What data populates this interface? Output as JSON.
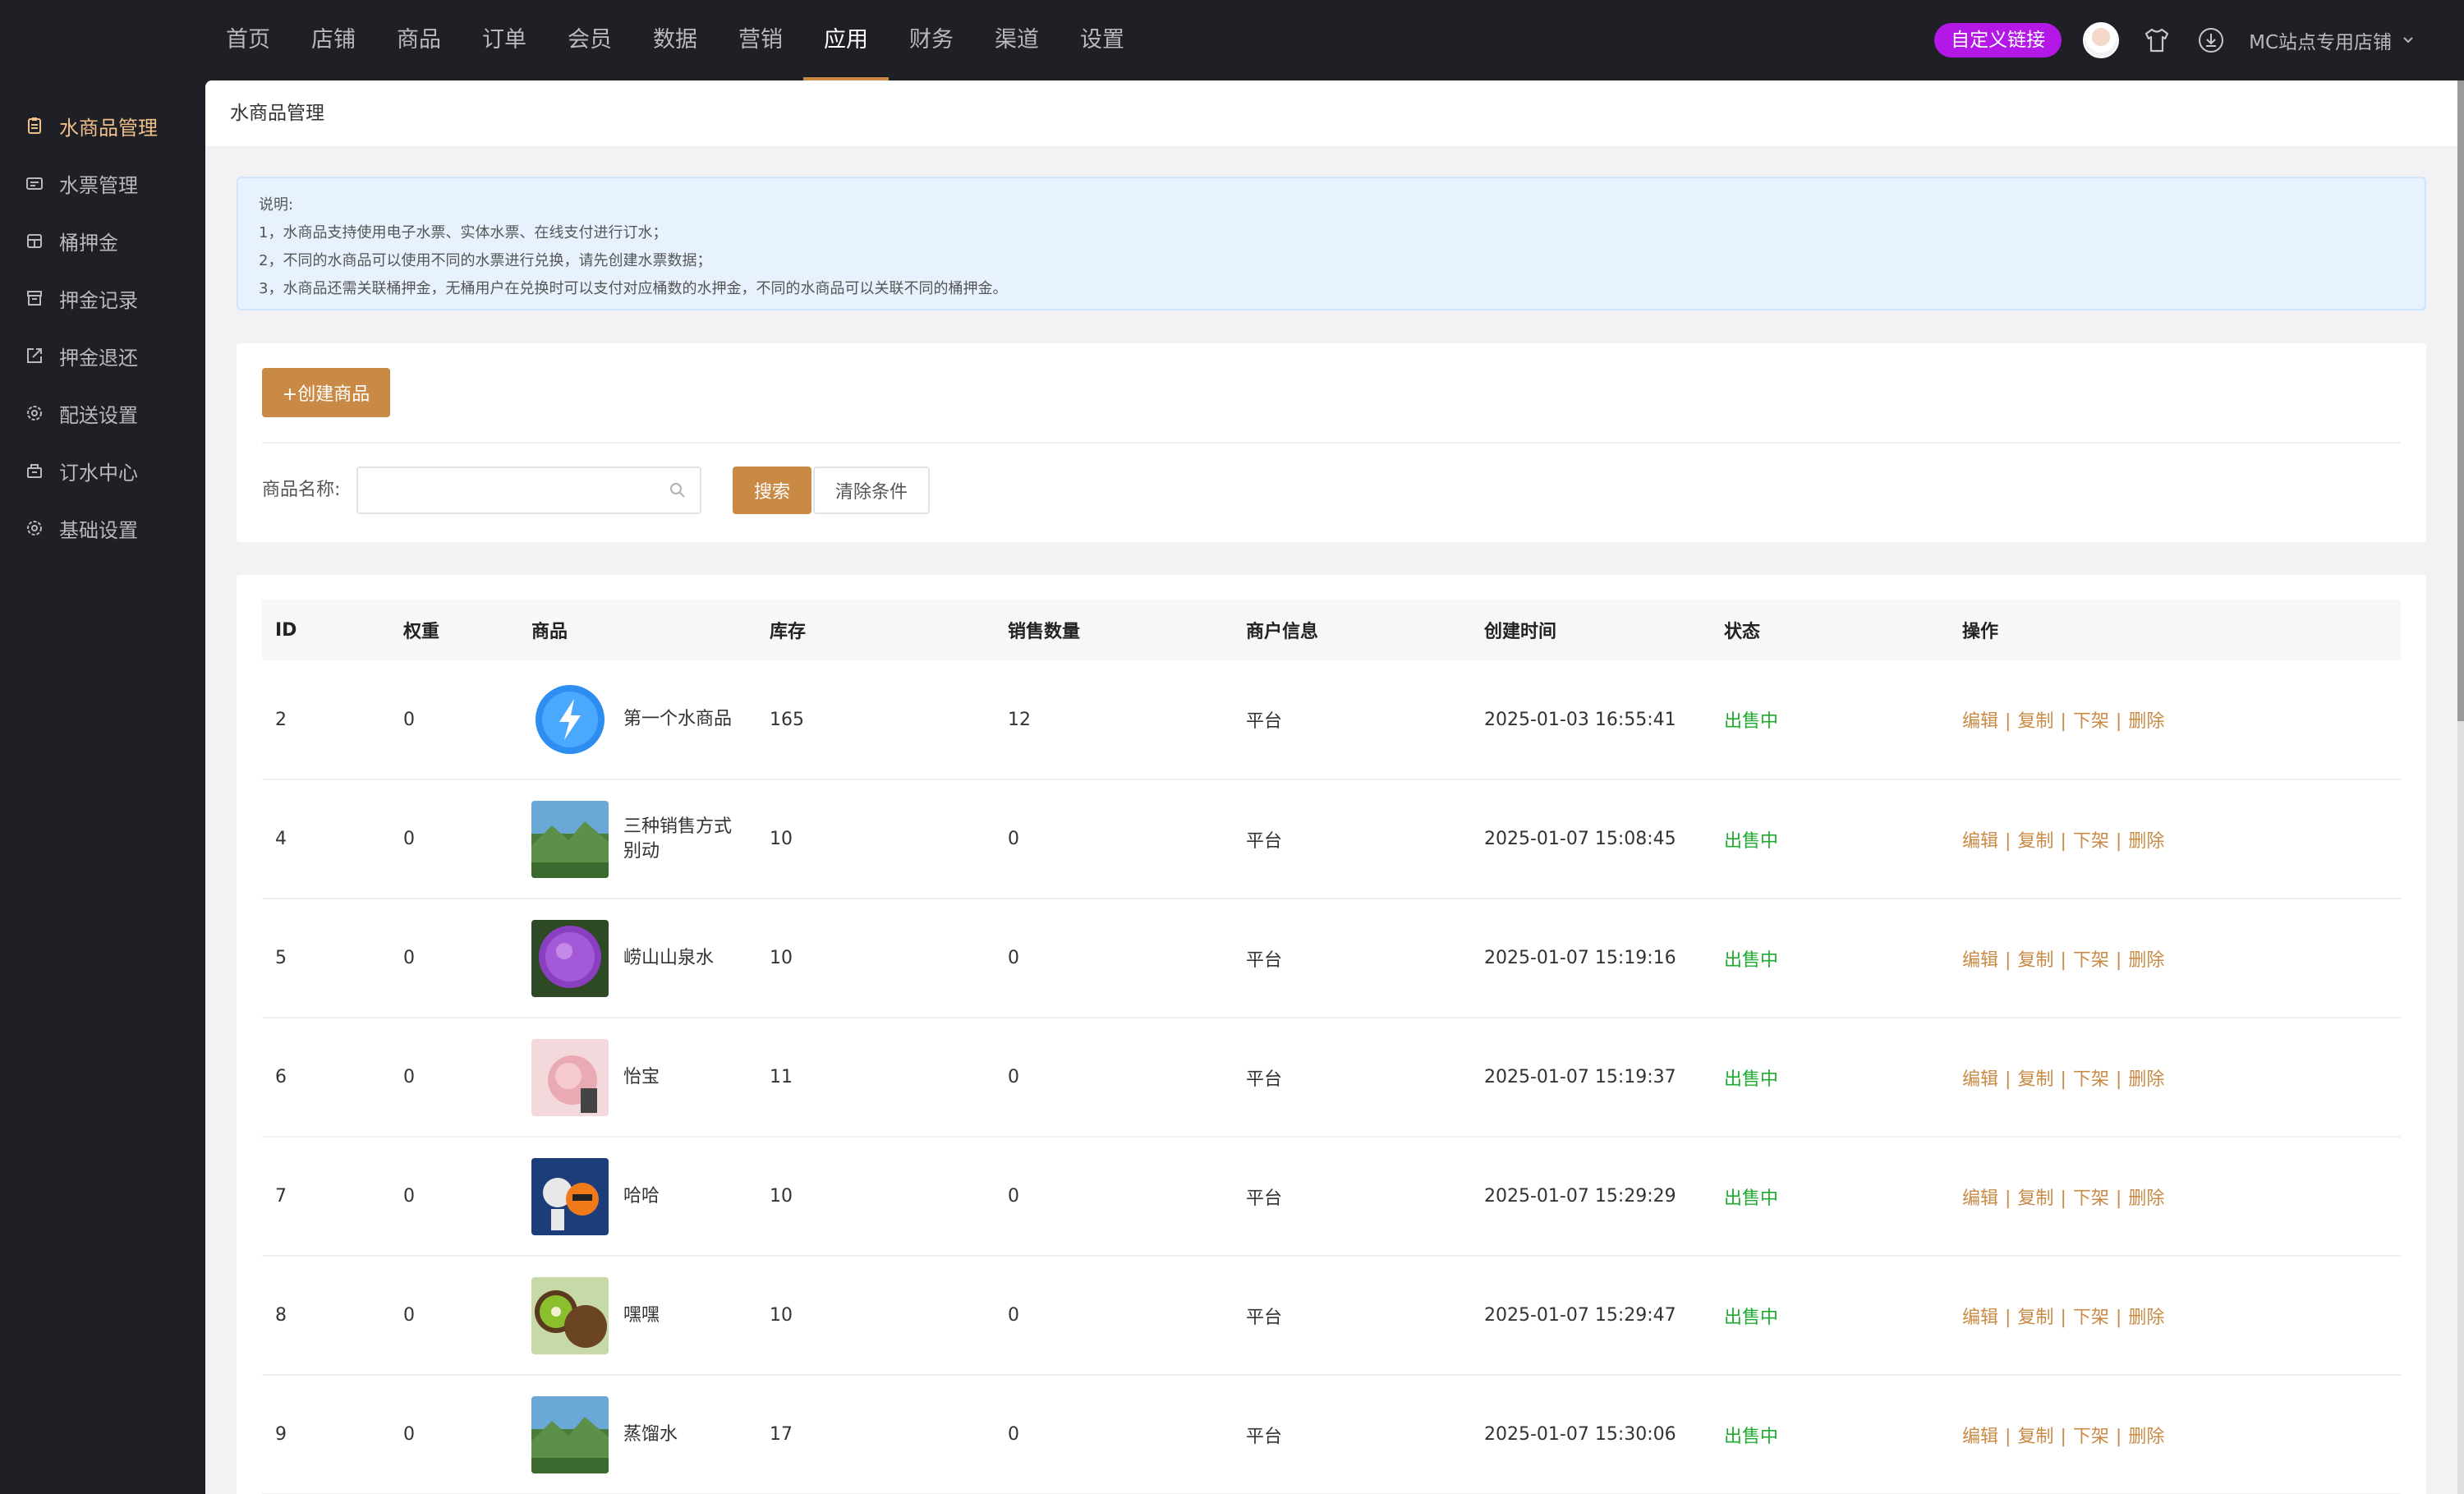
{
  "topnav": [
    "首页",
    "店铺",
    "商品",
    "订单",
    "会员",
    "数据",
    "营销",
    "应用",
    "财务",
    "渠道",
    "设置"
  ],
  "topright": {
    "custom_link": "自定义链接",
    "store": "MC站点专用店铺"
  },
  "sidebar": [
    {
      "label": "水商品管理",
      "icon": "clipboard-icon"
    },
    {
      "label": "水票管理",
      "icon": "ticket-icon"
    },
    {
      "label": "桶押金",
      "icon": "bucket-icon"
    },
    {
      "label": "押金记录",
      "icon": "record-icon"
    },
    {
      "label": "押金退还",
      "icon": "refund-icon"
    },
    {
      "label": "配送设置",
      "icon": "gear-icon"
    },
    {
      "label": "订水中心",
      "icon": "center-icon"
    },
    {
      "label": "基础设置",
      "icon": "gear-icon"
    }
  ],
  "page_title": "水商品管理",
  "notice": {
    "title": "说明:",
    "lines": [
      "1，水商品支持使用电子水票、实体水票、在线支付进行订水；",
      "2，不同的水商品可以使用不同的水票进行兑换，请先创建水票数据；",
      "3，水商品还需关联桶押金，无桶用户在兑换时可以支付对应桶数的水押金，不同的水商品可以关联不同的桶押金。"
    ]
  },
  "toolbar": {
    "create": "+创建商品",
    "search_label": "商品名称:",
    "search_placeholder": "",
    "search": "搜索",
    "clear": "清除条件"
  },
  "table": {
    "headers": [
      "ID",
      "权重",
      "商品",
      "库存",
      "销售数量",
      "商户信息",
      "创建时间",
      "状态",
      "操作"
    ],
    "rows": [
      {
        "id": "2",
        "weight": "0",
        "name": "第一个水商品",
        "stock": "165",
        "sales": "12",
        "merchant": "平台",
        "time": "2025-01-03 16:55:41",
        "status": "出售中"
      },
      {
        "id": "4",
        "weight": "0",
        "name": "三种销售方式别动",
        "stock": "10",
        "sales": "0",
        "merchant": "平台",
        "time": "2025-01-07 15:08:45",
        "status": "出售中"
      },
      {
        "id": "5",
        "weight": "0",
        "name": "崂山山泉水",
        "stock": "10",
        "sales": "0",
        "merchant": "平台",
        "time": "2025-01-07 15:19:16",
        "status": "出售中"
      },
      {
        "id": "6",
        "weight": "0",
        "name": "怡宝",
        "stock": "11",
        "sales": "0",
        "merchant": "平台",
        "time": "2025-01-07 15:19:37",
        "status": "出售中"
      },
      {
        "id": "7",
        "weight": "0",
        "name": "哈哈",
        "stock": "10",
        "sales": "0",
        "merchant": "平台",
        "time": "2025-01-07 15:29:29",
        "status": "出售中"
      },
      {
        "id": "8",
        "weight": "0",
        "name": "嘿嘿",
        "stock": "10",
        "sales": "0",
        "merchant": "平台",
        "time": "2025-01-07 15:29:47",
        "status": "出售中"
      },
      {
        "id": "9",
        "weight": "0",
        "name": "蒸馏水",
        "stock": "17",
        "sales": "0",
        "merchant": "平台",
        "time": "2025-01-07 15:30:06",
        "status": "出售中"
      }
    ],
    "ops": [
      "编辑",
      "复制",
      "下架",
      "删除"
    ]
  },
  "colors": {
    "accent": "#c98a45",
    "status_green": "#1faa30",
    "custom_link": "#b318e6",
    "nav_bg": "#1f2026"
  }
}
